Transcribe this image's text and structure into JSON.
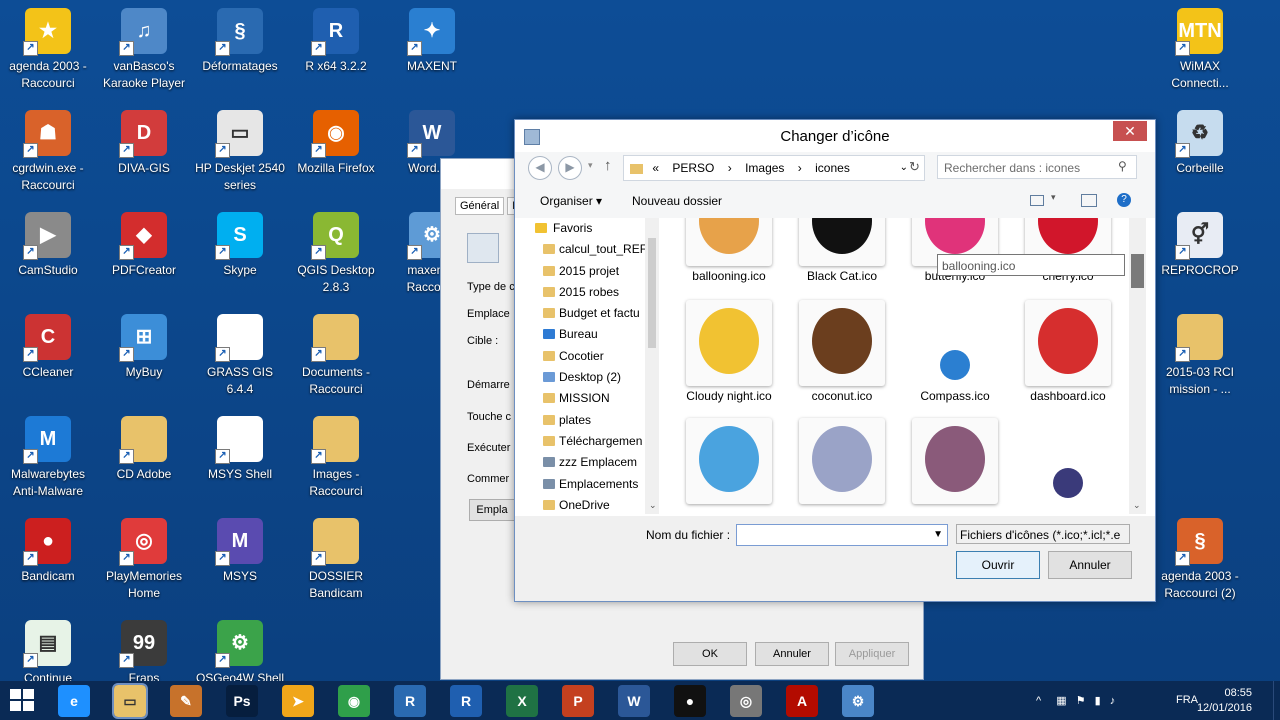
{
  "desktop": {
    "icons": [
      {
        "label": "agenda 2003 - Raccourci",
        "color": "#f3c318",
        "glyph": "★"
      },
      {
        "label": "vanBasco's Karaoke Player",
        "color": "#4e88c8",
        "glyph": "♫"
      },
      {
        "label": "Déformatages",
        "color": "#2a6ab1",
        "glyph": "§"
      },
      {
        "label": "R x64 3.2.2",
        "color": "#1f5fb0",
        "glyph": "R"
      },
      {
        "label": "MAXENT",
        "color": "#2a7fd1",
        "glyph": "✦"
      },
      {
        "label": "cgrdwin.exe - Raccourci",
        "color": "#d9622a",
        "glyph": "☗"
      },
      {
        "label": "DIVA-GIS",
        "color": "#d23c3c",
        "glyph": "D"
      },
      {
        "label": "HP Deskjet 2540 series",
        "color": "#e6e6e6",
        "glyph": "▭"
      },
      {
        "label": "Mozilla Firefox",
        "color": "#e66000",
        "glyph": "◉"
      },
      {
        "label": "Word.c...",
        "color": "#2b5797",
        "glyph": "W"
      },
      {
        "label": "CamStudio",
        "color": "#8a8a8a",
        "glyph": "▶"
      },
      {
        "label": "PDFCreator",
        "color": "#d32d2d",
        "glyph": "◆"
      },
      {
        "label": "Skype",
        "color": "#00aff0",
        "glyph": "S"
      },
      {
        "label": "QGIS Desktop 2.8.3",
        "color": "#8ab833",
        "glyph": "Q"
      },
      {
        "label": "maxent... Raccou...",
        "color": "#5e9bd6",
        "glyph": "⚙"
      },
      {
        "label": "CCleaner",
        "color": "#cc3333",
        "glyph": "C"
      },
      {
        "label": "MyBuy",
        "color": "#3c8ed8",
        "glyph": "⊞"
      },
      {
        "label": "GRASS GIS 6.4.4",
        "color": "#ffffff",
        "glyph": ""
      },
      {
        "label": "Documents - Raccourci",
        "color": "#e8c26a",
        "glyph": ""
      },
      {
        "label": "Malwarebytes Anti-Malware",
        "color": "#1d7ad6",
        "glyph": "M"
      },
      {
        "label": "CD Adobe",
        "color": "#e8c26a",
        "glyph": ""
      },
      {
        "label": "MSYS Shell",
        "color": "#ffffff",
        "glyph": ""
      },
      {
        "label": "Images - Raccourci",
        "color": "#e8c26a",
        "glyph": ""
      },
      {
        "label": "Bandicam",
        "color": "#cc1f1f",
        "glyph": "●"
      },
      {
        "label": "PlayMemories Home",
        "color": "#e03b3b",
        "glyph": "◎"
      },
      {
        "label": "MSYS",
        "color": "#5a4bb0",
        "glyph": "M"
      },
      {
        "label": "DOSSIER Bandicam",
        "color": "#e8c26a",
        "glyph": ""
      },
      {
        "label": "Continue",
        "color": "#e7f3e7",
        "glyph": "▤"
      },
      {
        "label": "Fraps",
        "color": "#3b3b3b",
        "glyph": "99"
      },
      {
        "label": "OSGeo4W Shell",
        "color": "#3ba34a",
        "glyph": "⚙"
      },
      {
        "label": "WiMAX Connecti...",
        "color": "#f3c318",
        "glyph": "MTN"
      },
      {
        "label": "Corbeille",
        "color": "#c6dcee",
        "glyph": "♻"
      },
      {
        "label": "REPROCROP",
        "color": "#e8ecf4",
        "glyph": "⚥"
      },
      {
        "label": "2015-03 RCI mission - ...",
        "color": "#e8c26a",
        "glyph": ""
      },
      {
        "label": "agenda 2003 - Raccourci (2)",
        "color": "#d9622a",
        "glyph": "§"
      }
    ]
  },
  "props_dialog": {
    "tabs": [
      "Général",
      "Ra"
    ],
    "rows": [
      "Type de c",
      "Emplace",
      "Cible :",
      "Démarre",
      "Touche c",
      "Exécuter",
      "Commer"
    ],
    "empl_btn": "Empla",
    "ok": "OK",
    "cancel": "Annuler",
    "apply": "Appliquer"
  },
  "dialog": {
    "title": "Changer d’icône",
    "close": "✕",
    "path": [
      "«",
      "PERSO",
      "›",
      "Images",
      "›",
      "icones"
    ],
    "search_placeholder": "Rechercher dans : icones",
    "organize": "Organiser ▾",
    "new_folder": "Nouveau dossier",
    "nav": [
      "Favoris",
      "calcul_tout_REF",
      "2015 projet",
      "2015 robes",
      "Budget et factu",
      "Bureau",
      "Cocotier",
      "Desktop (2)",
      "MISSION",
      "plates",
      "Téléchargemen",
      "zzz Emplacem",
      "Emplacements",
      "OneDrive"
    ],
    "files": [
      {
        "name": "ballooning.ico",
        "color": "#e7a24a"
      },
      {
        "name": "Black Cat.ico",
        "color": "#111111"
      },
      {
        "name": "butterfly.ico",
        "color": "#e0337a"
      },
      {
        "name": "cherry.ico",
        "color": "#d1162b"
      },
      {
        "name": "Cloudy night.ico",
        "color": "#f1c232"
      },
      {
        "name": "coconut.ico",
        "color": "#6b3e1e"
      },
      {
        "name": "Compass.ico",
        "color": "#2b7fd1"
      },
      {
        "name": "dashboard.ico",
        "color": "#d62e2e"
      },
      {
        "name": "",
        "color": "#4aa3df"
      },
      {
        "name": "",
        "color": "#9aa3c7"
      },
      {
        "name": "",
        "color": "#8a5a7a"
      },
      {
        "name": "",
        "color": "#3a3a7a"
      }
    ],
    "tooltip": "ballooning.ico",
    "filename_label": "Nom du fichier :",
    "filename_value": "",
    "filetype": "Fichiers d'icônes (*.ico;*.icl;*.e",
    "open": "Ouvrir",
    "cancel": "Annuler"
  },
  "taskbar": {
    "icons": [
      {
        "name": "ie",
        "glyph": "e",
        "color": "#1e90ff"
      },
      {
        "name": "explorer",
        "glyph": "▭",
        "color": "#e8c26a"
      },
      {
        "name": "tool",
        "glyph": "✎",
        "color": "#c7722b"
      },
      {
        "name": "photoshop",
        "glyph": "Ps",
        "color": "#061e3e"
      },
      {
        "name": "fox",
        "glyph": "➤",
        "color": "#f0a61a"
      },
      {
        "name": "chrome",
        "glyph": "◉",
        "color": "#2f9f4a"
      },
      {
        "name": "r",
        "glyph": "R",
        "color": "#2a6ab1"
      },
      {
        "name": "rstudio",
        "glyph": "R",
        "color": "#1f5fb0"
      },
      {
        "name": "excel",
        "glyph": "X",
        "color": "#1f7244"
      },
      {
        "name": "powerpoint",
        "glyph": "P",
        "color": "#c4401f"
      },
      {
        "name": "word",
        "glyph": "W",
        "color": "#2b5797"
      },
      {
        "name": "record",
        "glyph": "●",
        "color": "#111111"
      },
      {
        "name": "disc",
        "glyph": "◎",
        "color": "#777777"
      },
      {
        "name": "acrobat",
        "glyph": "A",
        "color": "#b30b00"
      },
      {
        "name": "control",
        "glyph": "⚙",
        "color": "#4a86c8"
      }
    ],
    "lang": "FRA",
    "time": "08:55",
    "date": "12/01/2016"
  }
}
